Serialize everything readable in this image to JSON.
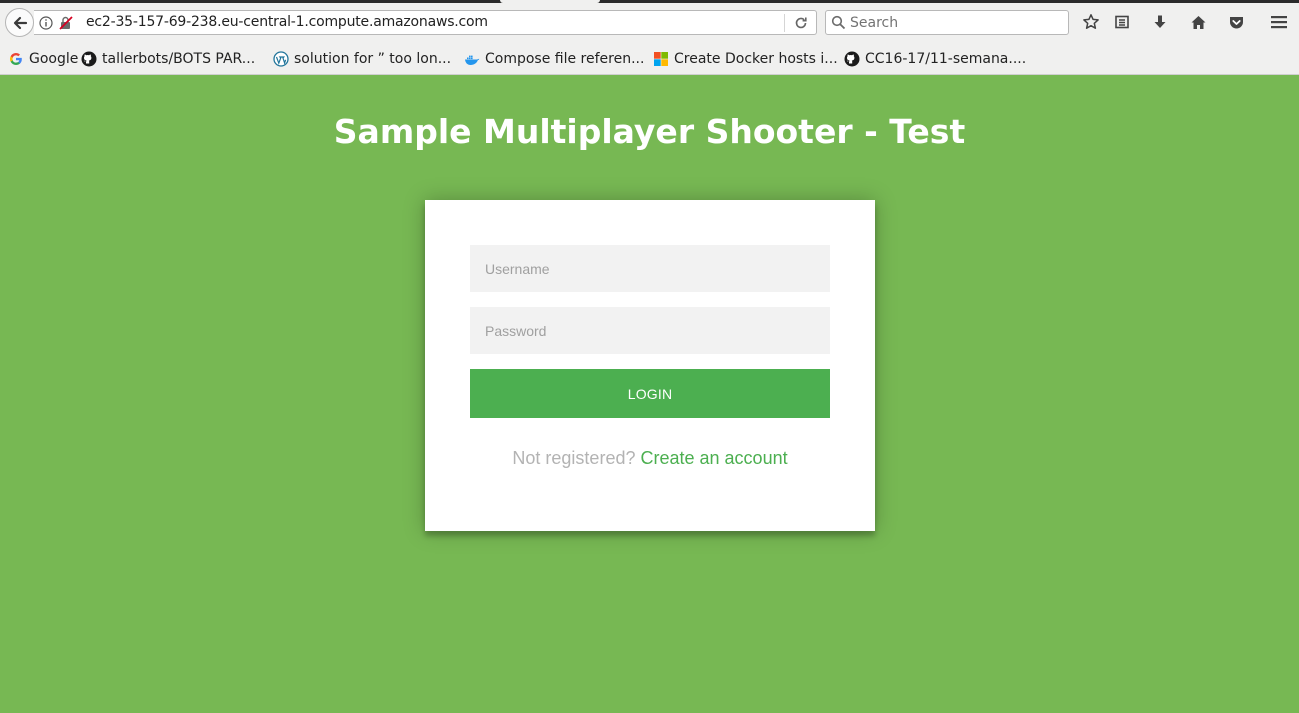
{
  "browser": {
    "url": "ec2-35-157-69-238.eu-central-1.compute.amazonaws.com",
    "search_placeholder": "Search",
    "toolbar_icons": [
      "bookmark-star-icon",
      "reading-list-icon",
      "download-icon",
      "home-icon",
      "pocket-icon",
      "menu-icon"
    ]
  },
  "bookmarks": [
    {
      "label": "Google",
      "icon": "google-icon"
    },
    {
      "label": "tallerbots/BOTS PAR...",
      "icon": "github-icon"
    },
    {
      "label": "solution for ” too lon...",
      "icon": "wordpress-icon"
    },
    {
      "label": "Compose file referen...",
      "icon": "docker-icon"
    },
    {
      "label": "Create Docker hosts i...",
      "icon": "microsoft-icon"
    },
    {
      "label": "CC16-17/11-semana....",
      "icon": "github-icon"
    }
  ],
  "page": {
    "title": "Sample Multiplayer Shooter - Test",
    "background_color": "#77b853",
    "accent_color": "#4caf50"
  },
  "login_form": {
    "username_placeholder": "Username",
    "password_placeholder": "Password",
    "login_label": "LOGIN",
    "register_prompt": "Not registered?",
    "register_link": "Create an account"
  }
}
